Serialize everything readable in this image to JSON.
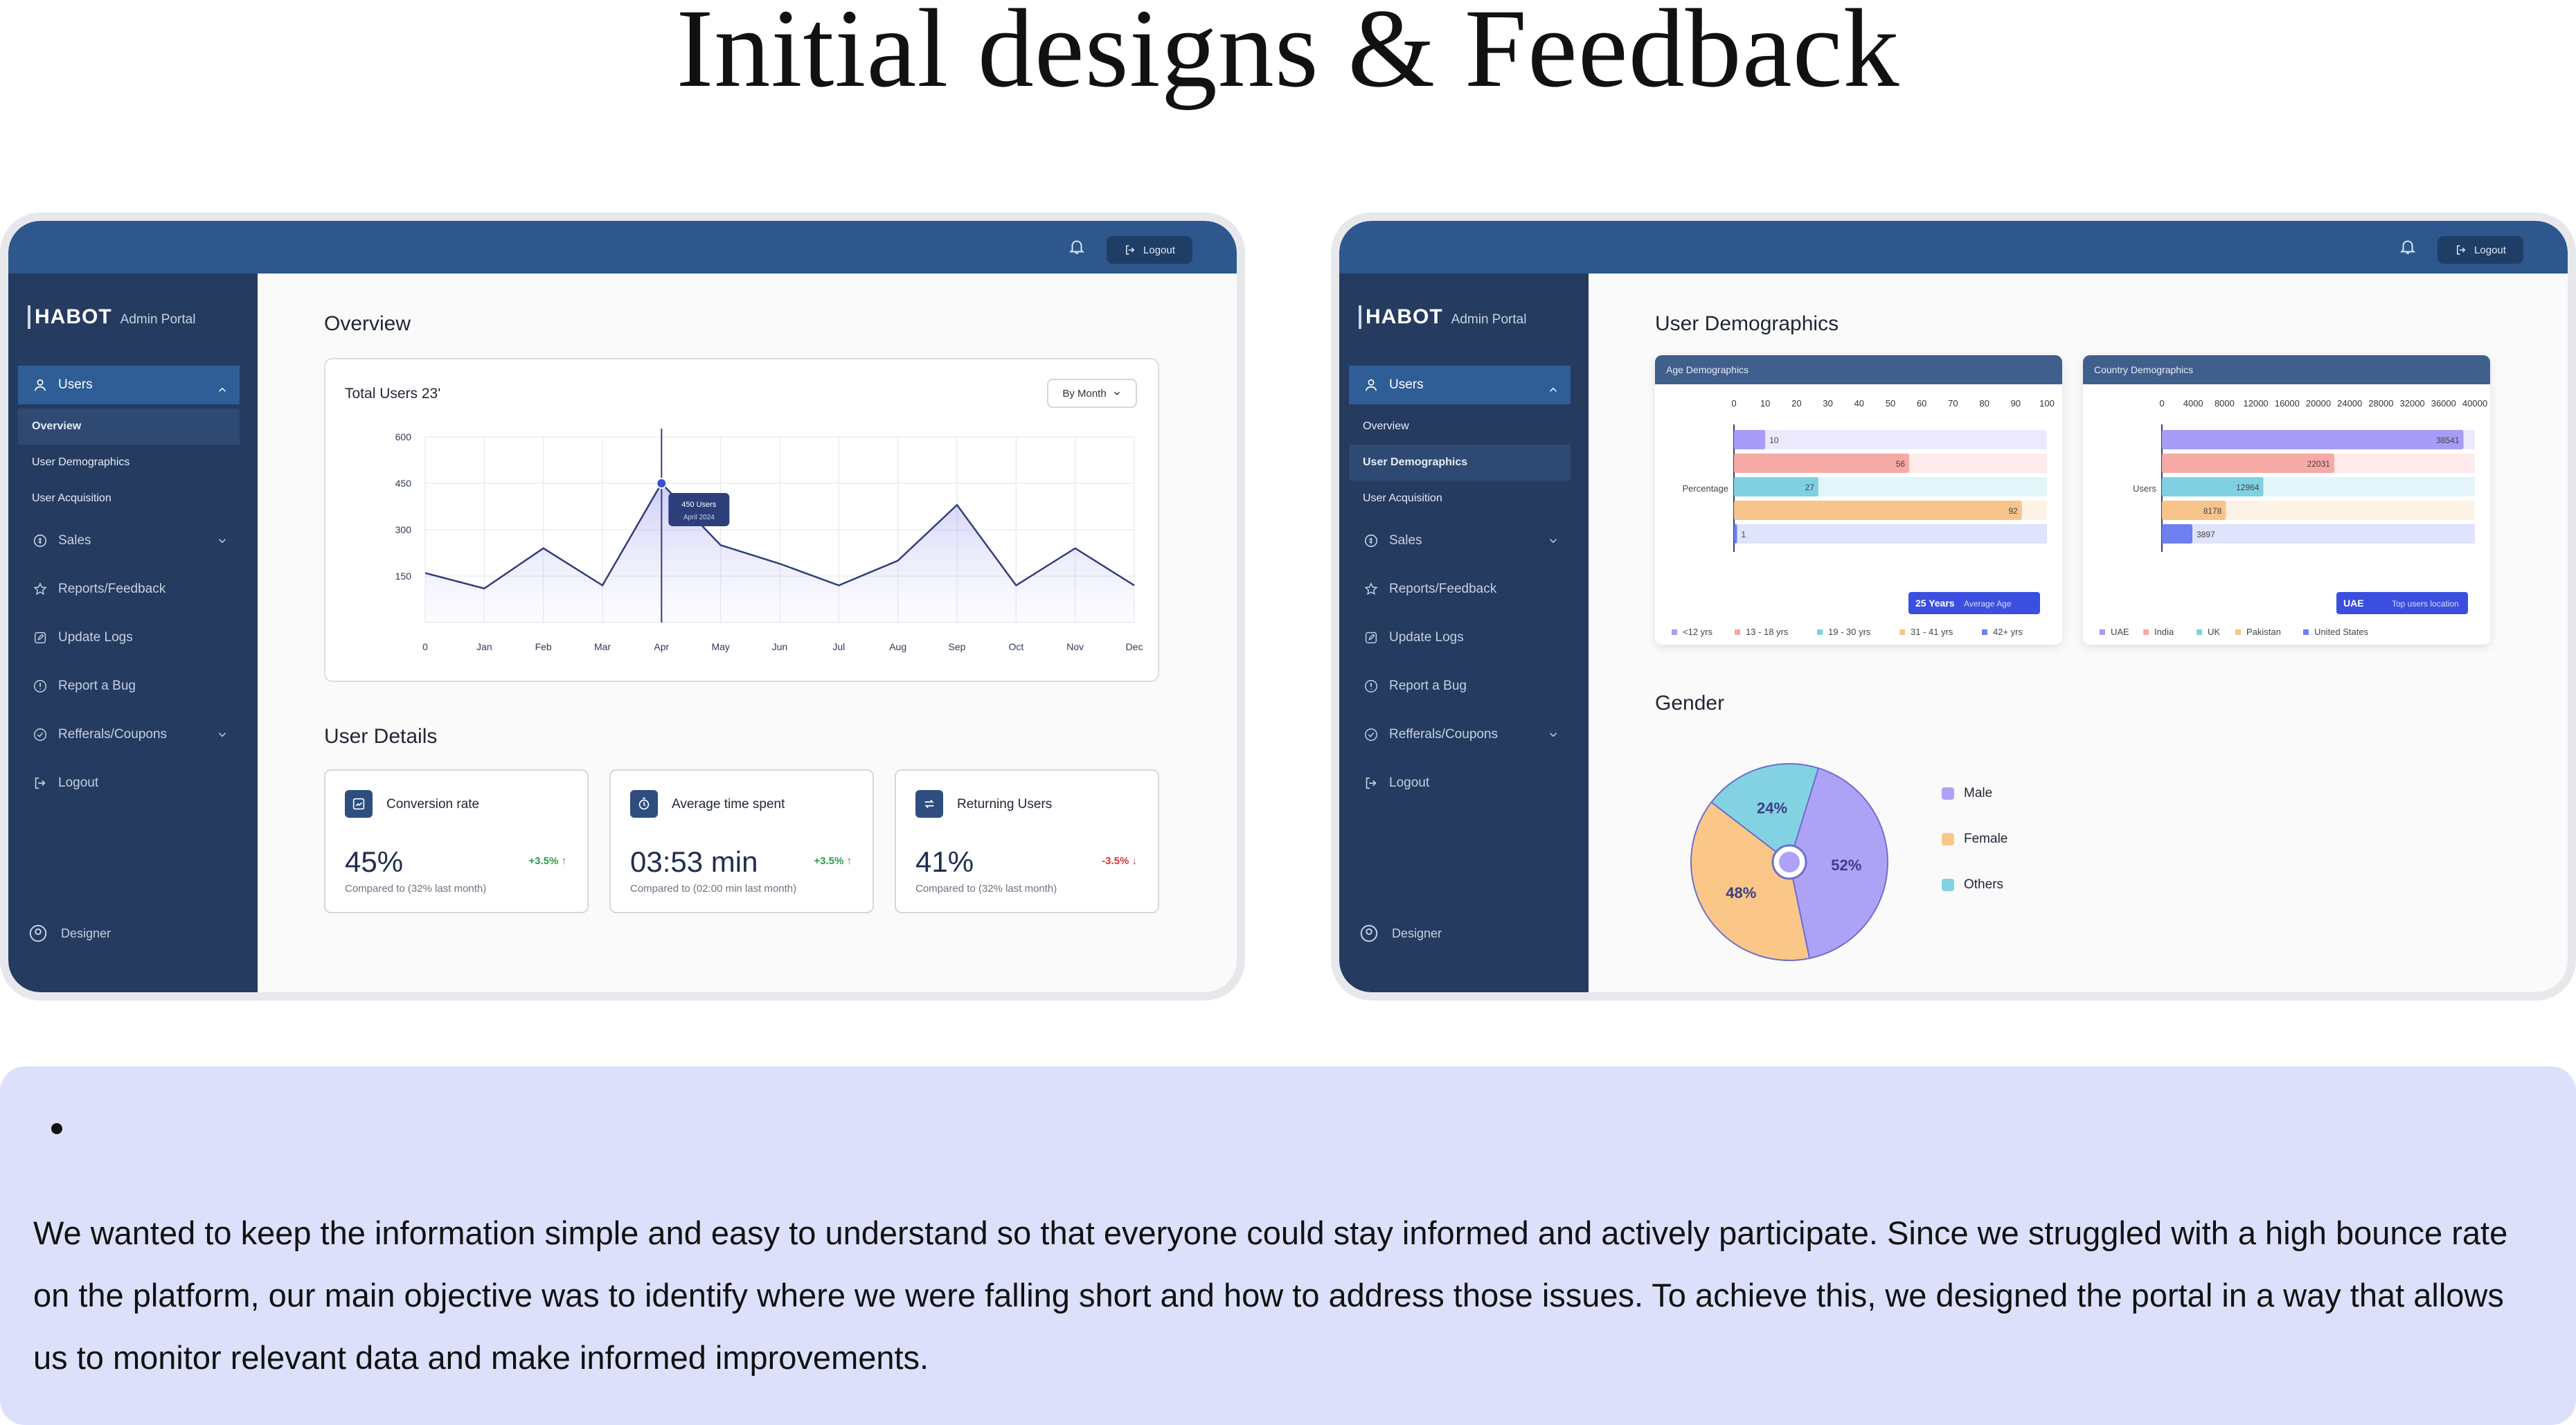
{
  "headline": "Initial designs & Feedback",
  "common": {
    "logout_button": "Logout",
    "brand_logo": "HABOT",
    "brand_sub": "Admin Portal",
    "nav": {
      "users": "Users",
      "overview": "Overview",
      "user_demographics": "User Demographics",
      "user_acquisition": "User Acquisition",
      "sales": "Sales",
      "reports": "Reports/Feedback",
      "update_logs": "Update Logs",
      "report_bug": "Report a Bug",
      "referrals": "Refferals/Coupons",
      "logout": "Logout"
    },
    "designer": "Designer"
  },
  "screen1": {
    "overview_title": "Overview",
    "chart_title": "Total Users 23'",
    "by_month": "By Month",
    "tooltip_value": "450 Users",
    "tooltip_date": "April 2024",
    "details_title": "User Details",
    "stats": [
      {
        "label": "Conversion rate",
        "value": "45%",
        "change": "+3.5%",
        "direction": "up",
        "compare": "Compared to (32% last month)"
      },
      {
        "label": "Average time spent",
        "value": "03:53 min",
        "change": "+3.5%",
        "direction": "up",
        "compare": "Compared to (02:00 min last month)"
      },
      {
        "label": "Returning Users",
        "value": "41%",
        "change": "-3.5%",
        "direction": "down",
        "compare": "Compared to (32% last month)"
      }
    ]
  },
  "screen2": {
    "demographics_title": "User Demographics",
    "age_card_title": "Age Demographics",
    "country_card_title": "Country Demographics",
    "age_row_label": "Percentage",
    "country_row_label": "Users",
    "age_badge_value": "25 Years",
    "age_badge_label": "Average Age",
    "country_badge_value": "UAE",
    "country_badge_label": "Top users location",
    "gender_title": "Gender"
  },
  "chart_data": [
    {
      "type": "area",
      "title": "Total Users 23'",
      "categories": [
        "0",
        "Jan",
        "Feb",
        "Mar",
        "Apr",
        "May",
        "Jun",
        "Jul",
        "Aug",
        "Sep",
        "Oct",
        "Nov",
        "Dec"
      ],
      "values": [
        160,
        110,
        240,
        120,
        450,
        250,
        190,
        120,
        200,
        380,
        120,
        240,
        120
      ],
      "yticks": [
        "0",
        "150",
        "300",
        "450",
        "600"
      ],
      "ylim": [
        0,
        600
      ],
      "color": "#2f3e7d"
    },
    {
      "type": "bar",
      "title": "Age Demographics",
      "categories": [
        "<12 yrs",
        "13 - 18 yrs",
        "19 - 30 yrs",
        "31 - 41 yrs",
        "42+ yrs"
      ],
      "values": [
        10,
        56,
        27,
        92,
        1
      ],
      "colors": [
        "#a79cf7",
        "#f7a9a6",
        "#7fd1e1",
        "#f7c58c",
        "#6f7ff0"
      ],
      "xticks": [
        "0",
        "10",
        "20",
        "30",
        "40",
        "50",
        "60",
        "70",
        "80",
        "90",
        "100"
      ],
      "xlim": [
        0,
        100
      ]
    },
    {
      "type": "bar",
      "title": "Country Demographics",
      "categories": [
        "UAE",
        "India",
        "UK",
        "Pakistan",
        "United States"
      ],
      "values": [
        38541,
        22031,
        12964,
        8178,
        3897
      ],
      "colors": [
        "#a79cf7",
        "#f7a9a6",
        "#7fd1e1",
        "#f7c58c",
        "#6f7ff0"
      ],
      "xticks": [
        "0",
        "4000",
        "8000",
        "12000",
        "16000",
        "20000",
        "24000",
        "28000",
        "32000",
        "36000",
        "40000"
      ],
      "xlim": [
        0,
        40000
      ]
    },
    {
      "type": "pie",
      "title": "Gender",
      "categories": [
        "Male",
        "Female",
        "Others"
      ],
      "values": [
        52,
        48,
        24
      ],
      "labels": [
        "52%",
        "48%",
        "24%"
      ],
      "colors": [
        "#aea2f7",
        "#fac789",
        "#83d2e2"
      ]
    }
  ],
  "quote": "We wanted to keep the information simple and easy to understand so that everyone could stay informed and actively participate. Since we struggled with a high bounce rate on the platform, our main objective was to identify where we were falling short and how to address those issues. To achieve this, we designed the portal in a way that allows us to monitor relevant data and make informed improvements."
}
